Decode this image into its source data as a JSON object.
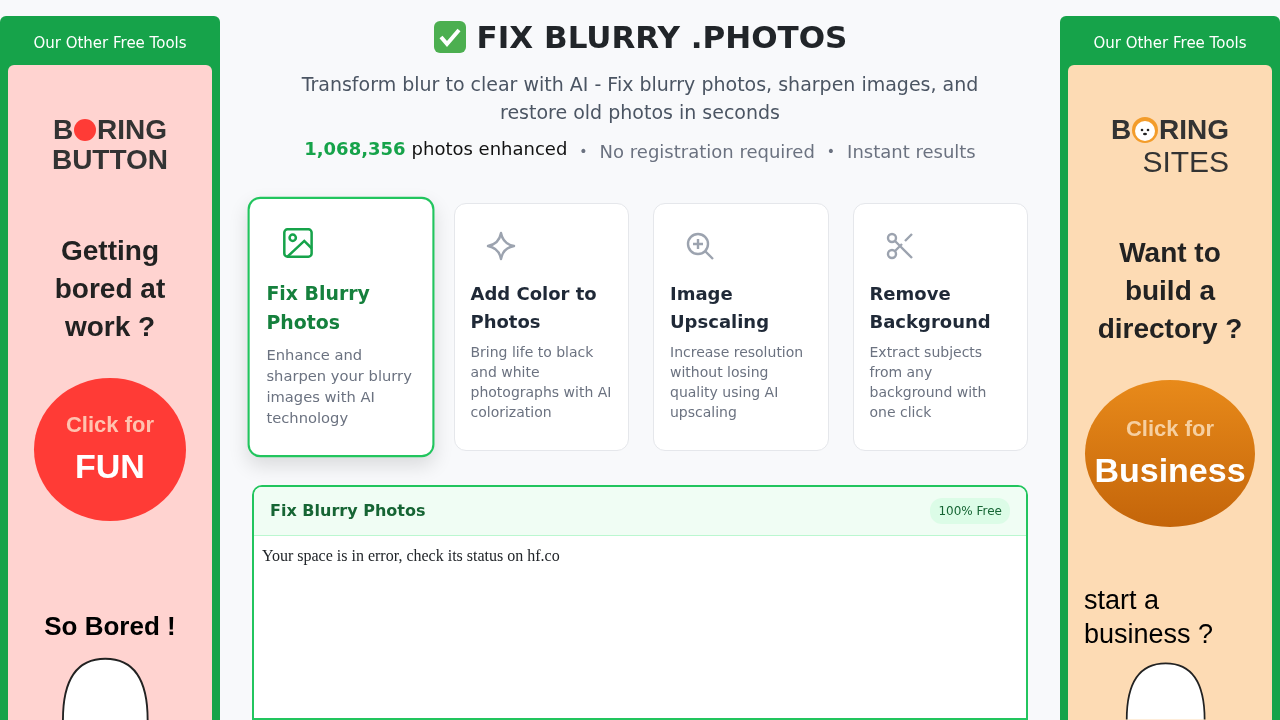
{
  "header": {
    "title": "FIX BLURRY .PHOTOS",
    "subtitle": "Transform blur to clear with AI - Fix blurry photos, sharpen images, and restore old photos in seconds",
    "stats": [
      {
        "kind": "count",
        "value": "1,068,356",
        "label": "photos enhanced"
      },
      {
        "kind": "sep",
        "label": "•"
      },
      {
        "kind": "plain",
        "label": "No registration required"
      },
      {
        "kind": "sep",
        "label": "•"
      },
      {
        "kind": "plain",
        "label": "Instant results"
      }
    ]
  },
  "sidebars": [
    {
      "heading": "Our Other Free Tools",
      "ad": {
        "kind": "button",
        "logo_start": "B",
        "logo_end": "RING",
        "logo_sub": "BUTTON",
        "headline": "Getting bored at work ?",
        "circle_small": "Click for",
        "circle_big": "FUN",
        "footer": "So Bored !"
      }
    },
    {
      "heading": "Our Other Free Tools",
      "ad": {
        "kind": "sites",
        "logo_start": "B",
        "logo_end": "RING",
        "logo_sub": "SITES",
        "headline": "Want to build a directory ?",
        "circle_small": "Click for",
        "circle_big": "Business",
        "footer": "start a business ?"
      }
    }
  ],
  "tools": [
    {
      "kind": "image",
      "title": "Fix Blurry Photos",
      "description": "Enhance and sharpen your blurry images with AI technology",
      "selected": true
    },
    {
      "kind": "sparkle",
      "title": "Add Color to Photos",
      "description": "Bring life to black and white photographs with AI colorization",
      "selected": false
    },
    {
      "kind": "zoom",
      "title": "Image Upscaling",
      "description": "Increase resolution without losing quality using AI upscaling",
      "selected": false
    },
    {
      "kind": "scissors",
      "title": "Remove Background",
      "description": "Extract subjects from any background with one click",
      "selected": false
    }
  ],
  "panel": {
    "title": "Fix Blurry Photos",
    "badge": "100% Free",
    "message": "Your space is in error, check its status on hf.co"
  }
}
